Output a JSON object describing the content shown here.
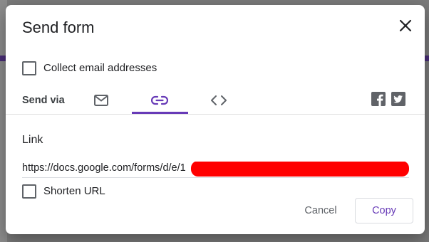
{
  "dialog": {
    "title": "Send form",
    "close_icon": "close-icon"
  },
  "options": {
    "collect_email_label": "Collect email addresses",
    "collect_email_checked": false
  },
  "send_via": {
    "label": "Send via",
    "tabs": [
      {
        "name": "email",
        "icon": "mail-icon",
        "selected": false
      },
      {
        "name": "link",
        "icon": "link-icon",
        "selected": true
      },
      {
        "name": "embed",
        "icon": "code-icon",
        "selected": false
      }
    ],
    "social": [
      {
        "name": "facebook",
        "icon": "facebook-icon"
      },
      {
        "name": "twitter",
        "icon": "twitter-icon"
      }
    ],
    "accent_color": "#673ab7"
  },
  "link_section": {
    "heading": "Link",
    "url_visible": "https://docs.google.com/forms/d/e/1",
    "shorten_label": "Shorten URL",
    "shorten_checked": false
  },
  "actions": {
    "cancel_label": "Cancel",
    "copy_label": "Copy"
  }
}
